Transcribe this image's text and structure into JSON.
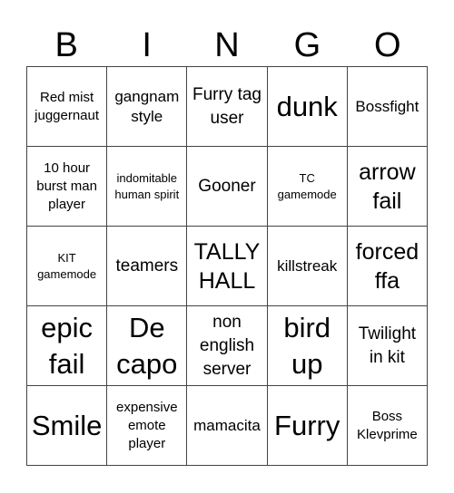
{
  "header": {
    "letters": [
      "B",
      "I",
      "N",
      "G",
      "O"
    ]
  },
  "board": {
    "cells": [
      "Red mist juggernaut",
      "gangnam style",
      "Furry tag user",
      "dunk",
      "Bossfight",
      "10 hour burst man player",
      "indomitable human spirit",
      "Gooner",
      "TC gamemode",
      "arrow fail",
      "KIT gamemode",
      "teamers",
      "TALLY HALL",
      "killstreak",
      "forced ffa",
      "epic fail",
      "De capo",
      "non english server",
      "bird up",
      "Twilight in kit",
      "Smile",
      "expensive emote player",
      "mamacita",
      "Furry",
      "Boss Klevprime"
    ]
  }
}
